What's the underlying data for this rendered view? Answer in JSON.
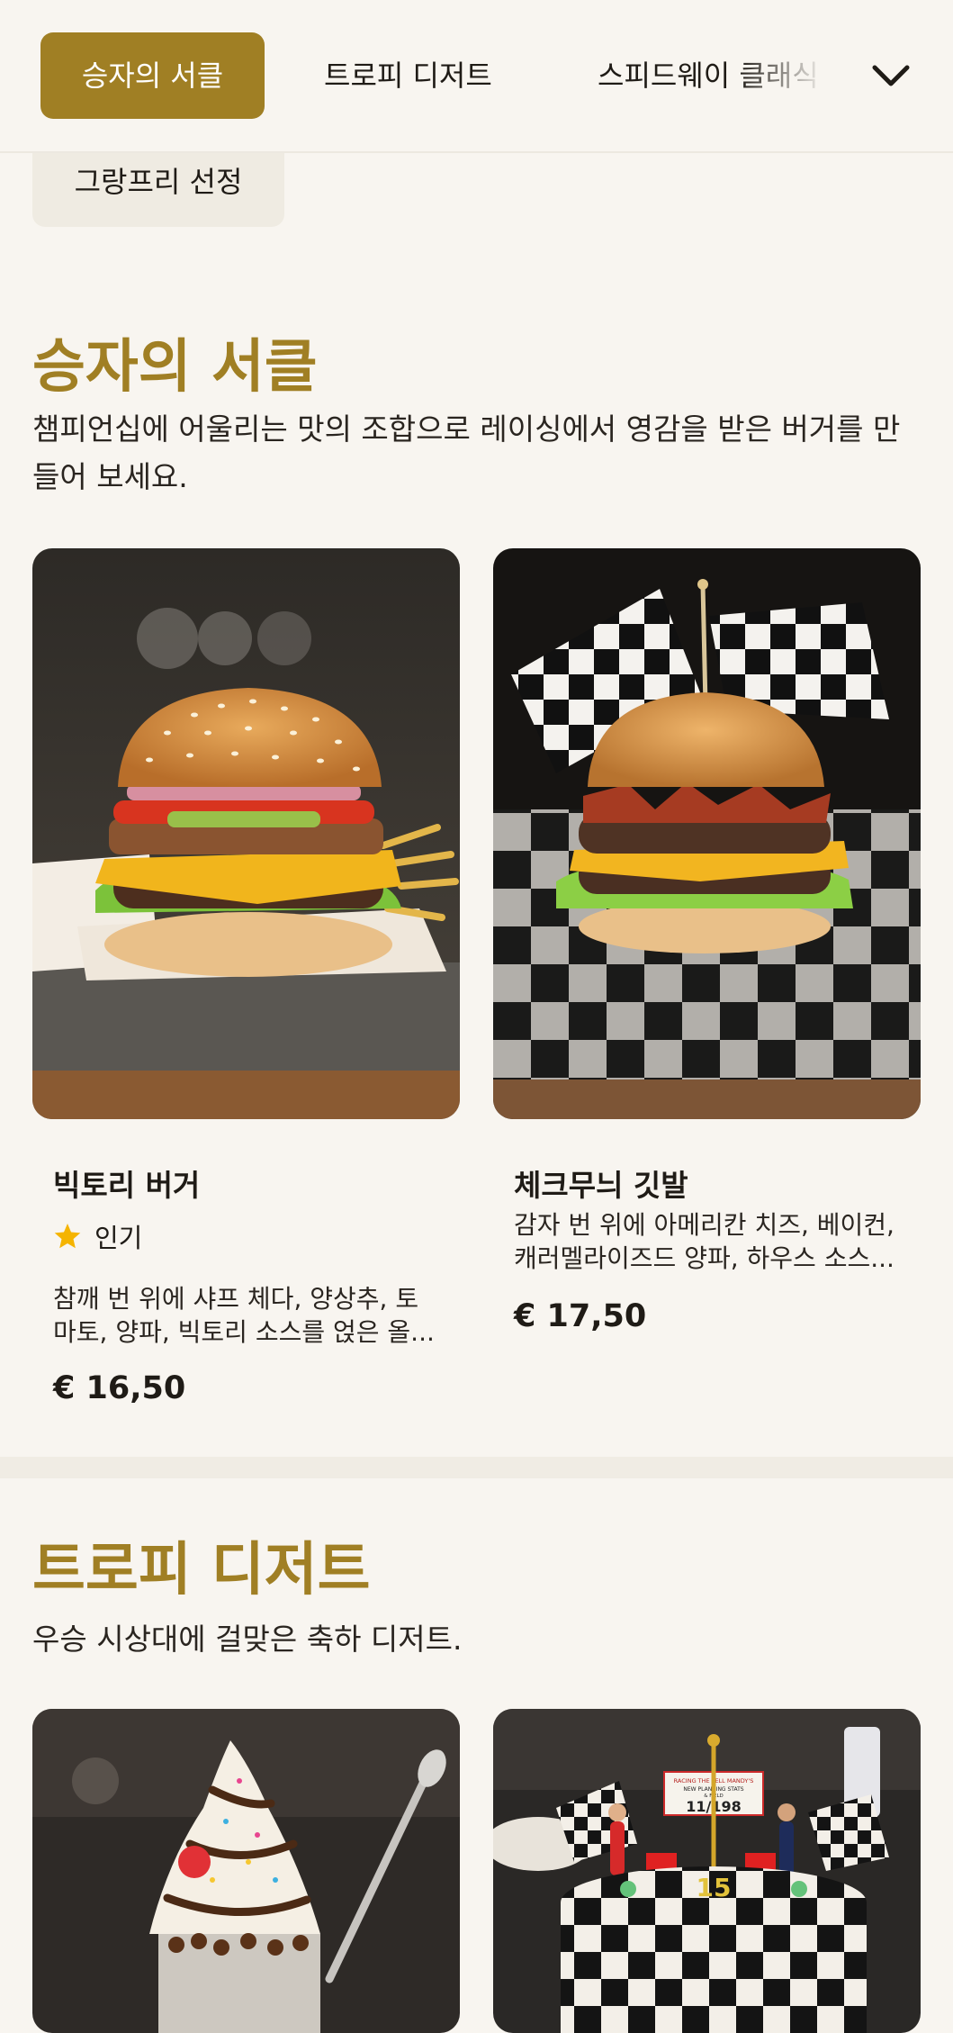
{
  "nav": {
    "tabs": [
      {
        "label": "승자의 서클",
        "active": true
      },
      {
        "label": "트로피 디저트",
        "active": false
      },
      {
        "label": "스피드웨이 클래식",
        "active": false
      }
    ],
    "overflow_tab": "그랑프리 선정",
    "expand_icon": "chevron-down-icon"
  },
  "sections": [
    {
      "title": "승자의 서클",
      "description": "챔피언십에 어울리는 맛의 조합으로 레이싱에서 영감을 받은 버거를 만들어 보세요.",
      "items": [
        {
          "name": "빅토리 버거",
          "badge": "인기",
          "badge_icon": "star-icon",
          "description": "참깨 번 위에 샤프 체다, 양상추, 토마토, 양파, 빅토리 소스를 얹은 올...",
          "price": "€ 16,50"
        },
        {
          "name": "체크무늬 깃발",
          "description": "감자 번 위에 아메리칸 치즈, 베이컨, 캐러멜라이즈드 양파, 하우스 소스...",
          "price": "€ 17,50"
        }
      ]
    },
    {
      "title": "트로피 디저트",
      "description": "우승 시상대에 걸맞은 축하 디저트.",
      "cake_sign": {
        "line1": "RACING THE FELL MANDY'S",
        "line2": "NEW PLANNING STATS",
        "line3": "& FIELD",
        "number": "11/198"
      },
      "cake_number": "15"
    }
  ],
  "colors": {
    "accent": "#a07f24",
    "background": "#f8f5f0",
    "star": "#f5b400"
  }
}
